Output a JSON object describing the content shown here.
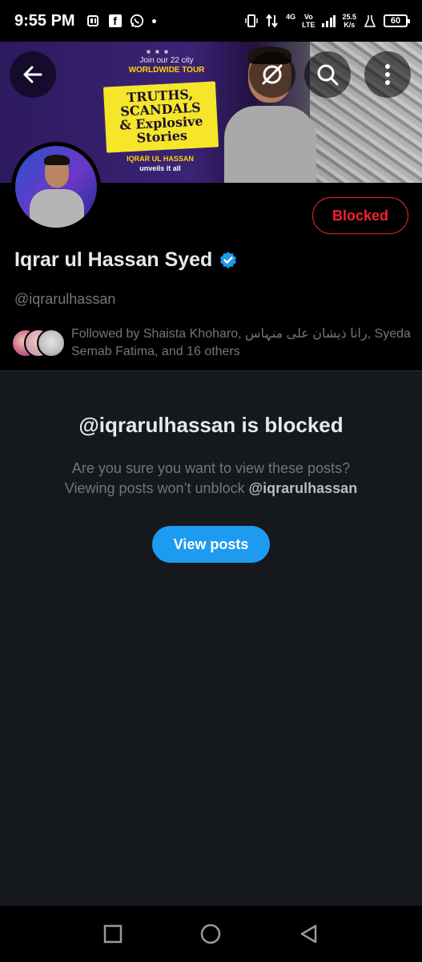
{
  "status_bar": {
    "time": "9:55 PM",
    "network_label": "4G",
    "volte_label_top": "Vo",
    "volte_label_bottom": "LTE",
    "speed_value": "25.5",
    "speed_unit": "K/s",
    "battery": "60"
  },
  "banner": {
    "tour_line1": "Join our 22 city",
    "tour_line2": "WORLDWIDE TOUR",
    "headline_line1": "TRUTHS,",
    "headline_line2": "SCANDALS",
    "headline_line3": "& Explosive",
    "headline_line4": "Stories",
    "host_name": "IQRAR UL HASSAN",
    "host_sub": "unveils it all"
  },
  "toolbar": {
    "back_icon": "arrow-left-icon",
    "grok_icon": "grok-icon",
    "search_icon": "search-icon",
    "more_icon": "more-vertical-icon"
  },
  "profile": {
    "blocked_label": "Blocked",
    "display_name": "Iqrar ul Hassan Syed",
    "handle": "@iqrarulhassan",
    "followed_by": "Followed by Shaista Khoharo, رانا ذیشان علی منہاس, Syeda Semab Fatima, and 16 others"
  },
  "blocked_notice": {
    "title": "@iqrarulhassan is blocked",
    "message_line1": "Are you sure you want to view these posts?",
    "message_prefix": "Viewing posts won’t unblock ",
    "message_handle": "@iqrarulhassan",
    "view_posts_label": "View posts"
  },
  "colors": {
    "accent_blue": "#1d9bf0",
    "blocked_red": "#f4212e",
    "background": "#000000",
    "panel": "#15181c"
  }
}
